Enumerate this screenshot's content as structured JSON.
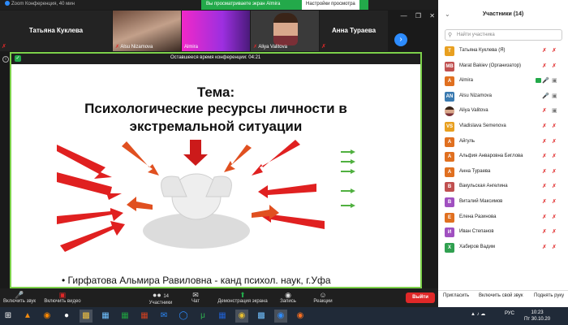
{
  "window": {
    "title": "Zoom Конференция, 40 мин"
  },
  "share_banner": {
    "text": "Вы просматриваете экран Almira",
    "options": "Настройки просмотра"
  },
  "thumbnails": [
    {
      "name": "Татьяна Куклева",
      "kind": "name-only"
    },
    {
      "name": "Alsu Nizamova",
      "kind": "video"
    },
    {
      "name": "Almira",
      "kind": "video"
    },
    {
      "name": "Aliya Valitova",
      "kind": "video"
    },
    {
      "name": "Анна Тураева",
      "kind": "name-only"
    }
  ],
  "meeting": {
    "timer": "Оставшееся время конференции: 04:21"
  },
  "slide": {
    "title_line1": "Тема:",
    "title_line2": "Психологические ресурсы личности в",
    "title_line3": "экстремальной ситуации",
    "bullet": "• Гирфатова Альмира Равиловна -  канд психол. наук, г.Уфа"
  },
  "participants": {
    "header": "Участники (14)",
    "search_placeholder": "Найти участника",
    "list": [
      {
        "initials": "Т",
        "name": "Татьяна Куклева (Я)",
        "color": "#e8a020",
        "mic": "off",
        "video": "off"
      },
      {
        "initials": "MB",
        "name": "Marat Bakiev (Организатор)",
        "color": "#c05050",
        "mic": "off",
        "video": "off"
      },
      {
        "initials": "A",
        "name": "Almira",
        "color": "#e07020",
        "mic": "on",
        "video": "on",
        "sharing": true
      },
      {
        "initials": "AN",
        "name": "Alsu Nizamova",
        "color": "#3a7ab0",
        "mic": "on",
        "video": "on"
      },
      {
        "initials": "",
        "name": "Aliya Valitova",
        "color": "#a06060",
        "mic": "off",
        "video": "on",
        "photo": true
      },
      {
        "initials": "VS",
        "name": "Vladislava Semenova",
        "color": "#e8a020",
        "mic": "off",
        "video": "off"
      },
      {
        "initials": "А",
        "name": "Айгуль",
        "color": "#e07020",
        "mic": "off",
        "video": "off"
      },
      {
        "initials": "А",
        "name": "Альфия Анваровна Биглова",
        "color": "#e07020",
        "mic": "off",
        "video": "off"
      },
      {
        "initials": "А",
        "name": "Анна Тураева",
        "color": "#e07020",
        "mic": "off",
        "video": "off"
      },
      {
        "initials": "В",
        "name": "Вакульская Ангелина",
        "color": "#c05050",
        "mic": "off",
        "video": "off"
      },
      {
        "initials": "В",
        "name": "Виталий Максимов",
        "color": "#a050c0",
        "mic": "off",
        "video": "off"
      },
      {
        "initials": "Е",
        "name": "Елена Разинова",
        "color": "#e07020",
        "mic": "off",
        "video": "off"
      },
      {
        "initials": "И",
        "name": "Иван Степанов",
        "color": "#a050c0",
        "mic": "off",
        "video": "off"
      },
      {
        "initials": "Х",
        "name": "Хабиров Вадим",
        "color": "#30a050",
        "mic": "off",
        "video": "off"
      }
    ],
    "footer": {
      "invite": "Пригласить",
      "unmute_self": "Включить свой звук",
      "raise_hand": "Поднять руку"
    }
  },
  "toolbar": {
    "audio": "Включить звук",
    "video": "Включить видео",
    "participants": "Участники",
    "participants_count": "14",
    "chat": "Чат",
    "share": "Демонстрация экрана",
    "record": "Запись",
    "reactions": "Реакции",
    "leave": "Выйти"
  },
  "taskbar": {
    "lang": "РУС",
    "time": "10:23",
    "date": "Пт 30.10.20"
  }
}
